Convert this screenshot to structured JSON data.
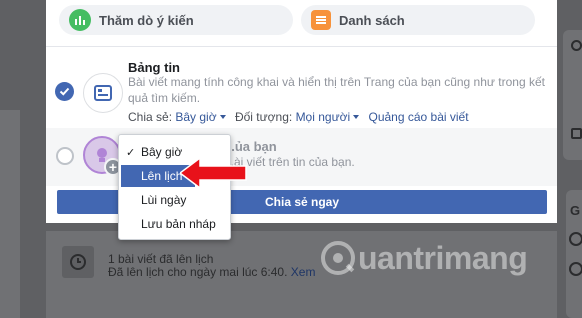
{
  "modal": {
    "top_options": [
      {
        "label": "Thăm dò ý kiến",
        "icon": "poll-icon"
      },
      {
        "label": "Danh sách",
        "icon": "list-icon"
      }
    ],
    "feed": {
      "title": "Bảng tin",
      "description": "Bài viết mang tính công khai và hiển thị trên Trang của bạn cũng như trong kết quả tìm kiếm.",
      "share_label": "Chia sẻ:",
      "share_value": "Bây giờ",
      "audience_label": "Đối tượng:",
      "audience_value": "Mọi người",
      "promote_link": "Quảng cáo bài viết",
      "selected": true
    },
    "story": {
      "title": "...ủa bạn",
      "description": "...ài viết trên tin của bạn.",
      "selected": false
    },
    "share_button": "Chia sẻ ngay"
  },
  "dropdown": {
    "items": [
      {
        "label": "Bây giờ",
        "checked": true
      },
      {
        "label": "Lên lịch",
        "highlighted": true
      },
      {
        "label": "Lùi ngày"
      },
      {
        "label": "Lưu bản nháp"
      }
    ]
  },
  "background": {
    "scheduled_title": "1 bài viết đã lên lịch",
    "scheduled_sub": "Đã lên lịch cho ngày mai lúc 6:40.",
    "scheduled_link": "Xem",
    "right_letter": "G"
  },
  "watermark": "uantrimang",
  "colors": {
    "primary": "#4267b2",
    "arrow": "#e8121a"
  }
}
